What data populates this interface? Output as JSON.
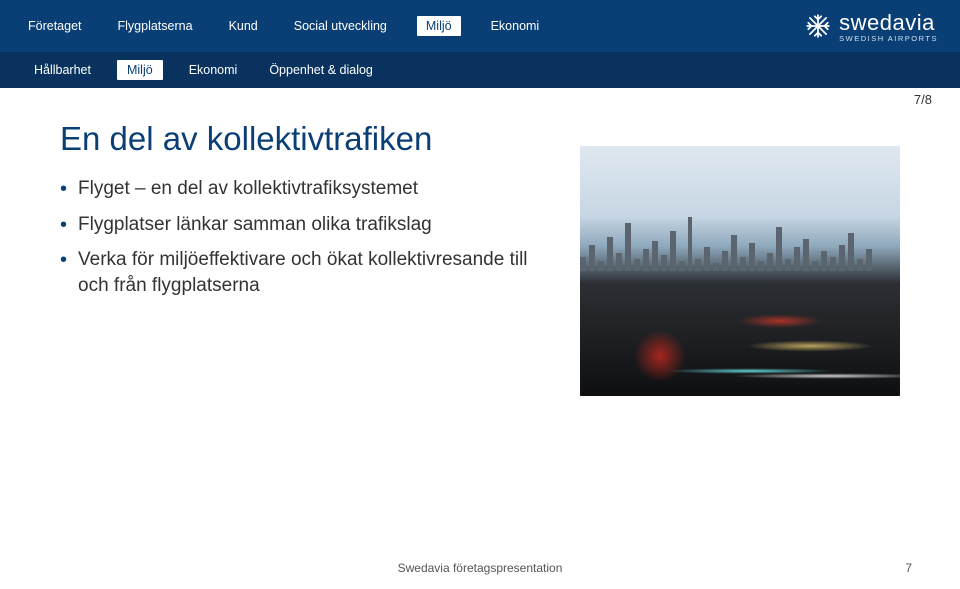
{
  "nav_primary": {
    "items": [
      {
        "label": "Företaget"
      },
      {
        "label": "Flygplatserna"
      },
      {
        "label": "Kund"
      },
      {
        "label": "Social utveckling"
      },
      {
        "label": "Miljö",
        "active": true
      },
      {
        "label": "Ekonomi"
      }
    ]
  },
  "nav_secondary": {
    "items": [
      {
        "label": "Hållbarhet"
      },
      {
        "label": "Miljö",
        "active": true
      },
      {
        "label": "Ekonomi"
      },
      {
        "label": "Öppenhet & dialog"
      }
    ]
  },
  "logo": {
    "word": "swedavia",
    "sub": "SWEDISH AIRPORTS"
  },
  "page_counter": "7/8",
  "title": "En del av kollektivtrafiken",
  "bullets": [
    "Flyget – en del av kollektivtrafiksystemet",
    "Flygplatser länkar samman olika trafikslag",
    "Verka för miljöeffektivare och ökat kollektivresande till och från flygplatserna"
  ],
  "footer": {
    "text": "Swedavia företagspresentation",
    "page": "7"
  }
}
